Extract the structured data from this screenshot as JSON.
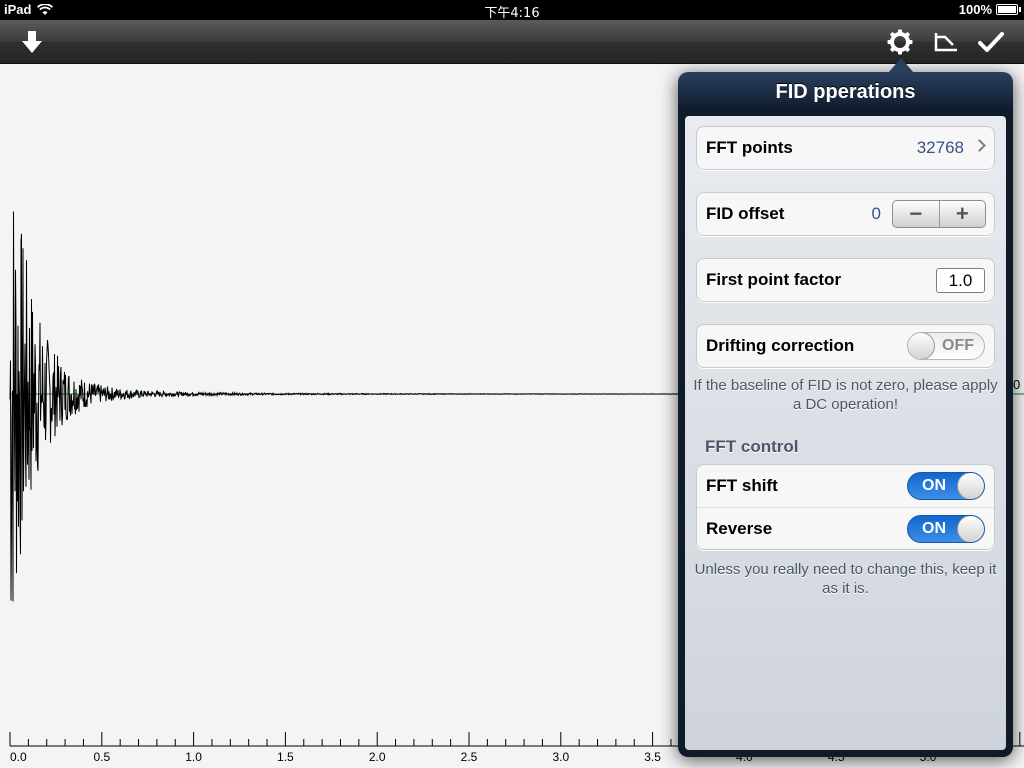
{
  "status_bar": {
    "carrier": "iPad",
    "time": "下午4:16",
    "battery": "100%"
  },
  "toolbar": {
    "left_icon": "download-arrow-icon",
    "right_icons": [
      "gear-icon",
      "phase-correction-icon",
      "checkmark-icon"
    ]
  },
  "plot": {
    "baseline_color": "#009000",
    "signal_color": "#000000",
    "x_ticks": [
      "0.0",
      "0.5",
      "1.0",
      "1.5",
      "2.0",
      "2.5",
      "3.0",
      "3.5",
      "4.0",
      "4.5",
      "5.0"
    ],
    "right_edge_label": "0"
  },
  "popover": {
    "title": "FID pperations",
    "fft_points": {
      "label": "FFT points",
      "value": "32768"
    },
    "fid_offset": {
      "label": "FID offset",
      "value": "0",
      "minus": "−",
      "plus": "+"
    },
    "first_point_factor": {
      "label": "First point factor",
      "value": "1.0"
    },
    "drifting_correction": {
      "label": "Drifting correction",
      "state": "OFF"
    },
    "drift_note": "If the baseline of FID is not zero, please apply a DC operation!",
    "fft_control_header": "FFT control",
    "fft_shift": {
      "label": "FFT shift",
      "state": "ON"
    },
    "reverse": {
      "label": "Reverse",
      "state": "ON"
    },
    "fft_note": "Unless you really need to change this, keep it as it is."
  }
}
